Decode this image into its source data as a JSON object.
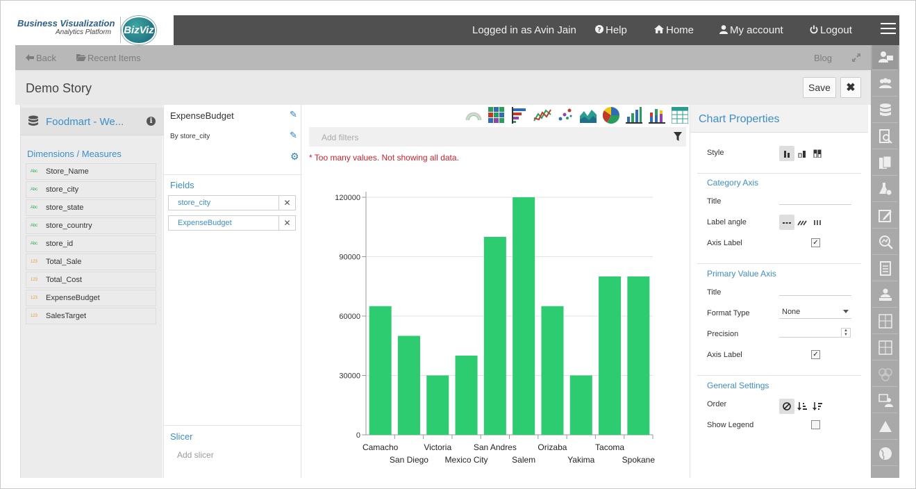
{
  "app": {
    "logo_title": "Business Visualization",
    "logo_subtitle": "Analytics Platform",
    "logo_badge": "BizViz"
  },
  "topnav": {
    "logged_in": "Logged in as Avin Jain",
    "help": "Help",
    "home": "Home",
    "account": "My account",
    "logout": "Logout"
  },
  "subnav": {
    "back": "Back",
    "recent": "Recent Items",
    "blog": "Blog"
  },
  "story": {
    "title": "Demo Story",
    "save": "Save",
    "close": "✖"
  },
  "datasource": {
    "name": "Foodmart - We...",
    "section_title": "Dimensions / Measures",
    "fields": [
      {
        "name": "Store_Name",
        "type": "Abc"
      },
      {
        "name": "store_city",
        "type": "Abc"
      },
      {
        "name": "store_state",
        "type": "Abc"
      },
      {
        "name": "store_country",
        "type": "Abc"
      },
      {
        "name": "store_id",
        "type": "Abc"
      },
      {
        "name": "Total_Sale",
        "type": "123"
      },
      {
        "name": "Total_Cost",
        "type": "123"
      },
      {
        "name": "ExpenseBudget",
        "type": "123"
      },
      {
        "name": "SalesTarget",
        "type": "123"
      }
    ]
  },
  "config": {
    "measure": "ExpenseBudget",
    "by": "By store_city",
    "fields_title": "Fields",
    "fields": [
      "store_city",
      "ExpenseBudget"
    ],
    "slicer_title": "Slicer",
    "slicer_placeholder": "Add slicer"
  },
  "chart_area": {
    "filter_placeholder": "Add filters",
    "warning": "* Too many values. Not showing all data.",
    "chart_type_icons": [
      "gauge-chart-icon",
      "heatmap-chart-icon",
      "bar-chart-icon",
      "line-chart-icon",
      "scatter-chart-icon",
      "area-chart-icon",
      "pie-chart-icon",
      "column-chart-icon",
      "stacked-column-chart-icon",
      "table-chart-icon"
    ]
  },
  "chart_data": {
    "type": "bar",
    "categories": [
      "Camacho",
      "San Diego",
      "Victoria",
      "Mexico City",
      "San Andres",
      "Salem",
      "Orizaba",
      "Yakima",
      "Tacoma",
      "Spokane"
    ],
    "values": [
      65000,
      50000,
      30000,
      40000,
      100000,
      120000,
      65000,
      30000,
      80000,
      80000
    ],
    "y_ticks": [
      "0",
      "30000",
      "60000",
      "90000",
      "120000"
    ],
    "ylim": [
      0,
      120000
    ],
    "grid": true,
    "legend": false,
    "bar_color": "#2ecc71"
  },
  "properties": {
    "title": "Chart Properties",
    "style_label": "Style",
    "category_axis": "Category Axis",
    "title_label": "Title",
    "label_angle": "Label angle",
    "axis_label": "Axis Label",
    "primary_value_axis": "Primary Value Axis",
    "format_type": "Format Type",
    "format_value": "None",
    "precision": "Precision",
    "general_settings": "General Settings",
    "order": "Order",
    "show_legend": "Show Legend",
    "category_axis_label_checked": "✓",
    "value_axis_label_checked": "✓"
  },
  "colors": {
    "accent": "#3d8ec9",
    "topbar": "#505050",
    "bar": "#2ecc71",
    "warning": "#d0202a"
  },
  "right_toolbar": [
    "user-monitor-icon",
    "users-icon",
    "database-icon",
    "report-search-icon",
    "documents-icon",
    "flask-gear-icon",
    "edit-panel-icon",
    "search-chart-icon",
    "document-icon",
    "presenter-icon",
    "table-grid-icon",
    "table-grid-2-icon",
    "users-group-icon",
    "dashboard-user-icon",
    "drive-icon",
    "globe-icon"
  ]
}
